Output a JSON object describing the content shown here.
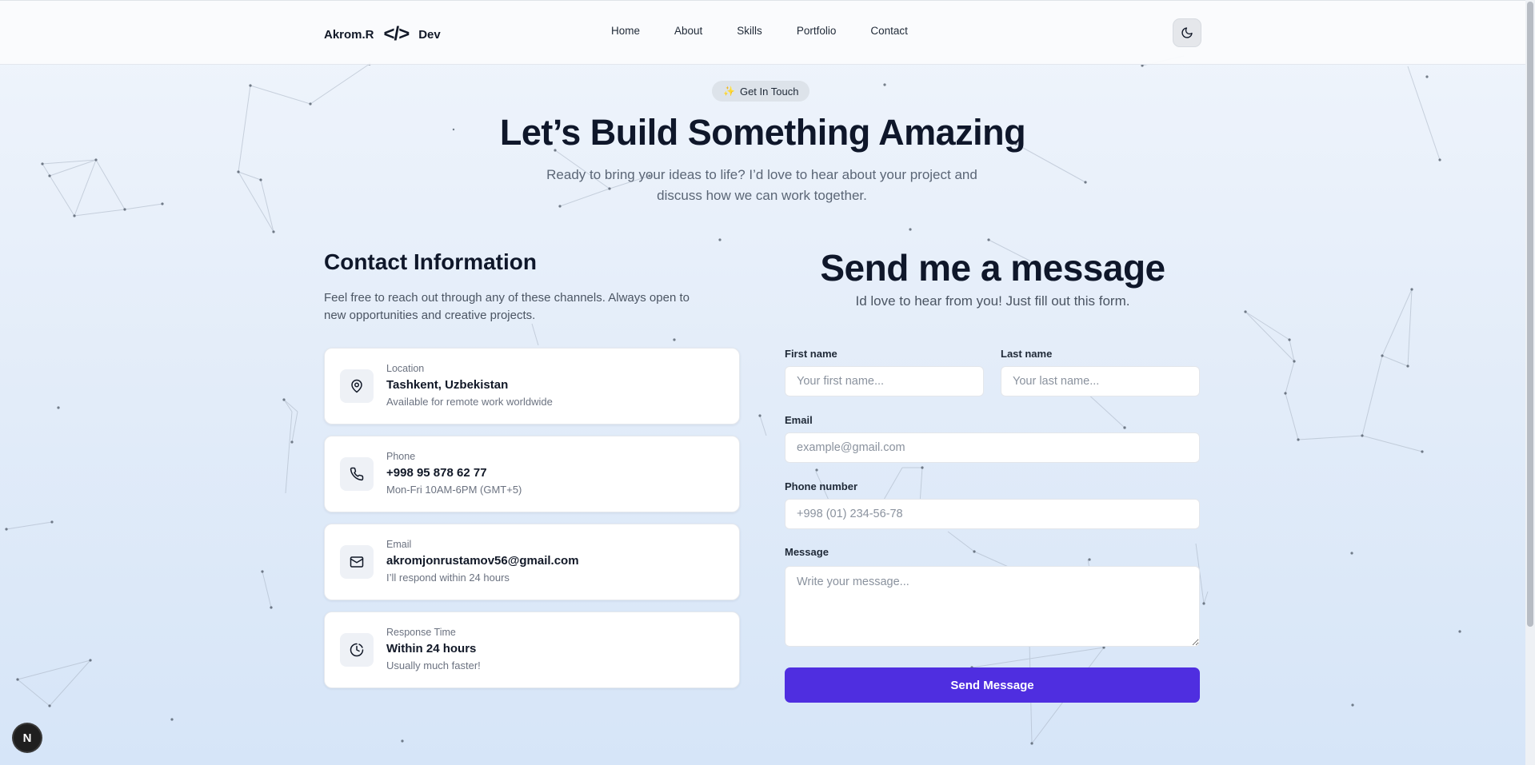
{
  "nav": {
    "brand_name": "Akrom.R",
    "brand_glyph": "</>",
    "brand_suffix": "Dev",
    "links": [
      "Home",
      "About",
      "Skills",
      "Portfolio",
      "Contact"
    ],
    "theme_icon": "moon-icon"
  },
  "hero": {
    "badge": "Get In Touch",
    "badge_icon": "sparkles-icon",
    "title": "Let’s Build Something Amazing",
    "subtitle": "Ready to bring your ideas to life? I’d love to hear about your project and discuss how we can work together."
  },
  "contact_info": {
    "title": "Contact Information",
    "description": "Feel free to reach out through any of these channels. Always open to new opportunities and creative projects.",
    "cards": [
      {
        "icon": "map-pin-icon",
        "label": "Location",
        "value": "Tashkent, Uzbekistan",
        "note": "Available for remote work worldwide"
      },
      {
        "icon": "phone-icon",
        "label": "Phone",
        "value": "+998 95 878 62 77",
        "note": "Mon-Fri 10AM-6PM (GMT+5)"
      },
      {
        "icon": "mail-icon",
        "label": "Email",
        "value": "akromjonrustamov56@gmail.com",
        "note": "I’ll respond within 24 hours"
      },
      {
        "icon": "clock-icon",
        "label": "Response Time",
        "value": "Within 24 hours",
        "note": "Usually much faster!"
      }
    ]
  },
  "form": {
    "title": "Send me a message",
    "subtitle": "Id love to hear from you! Just fill out this form.",
    "first_name": {
      "label": "First name",
      "placeholder": "Your first name...",
      "value": ""
    },
    "last_name": {
      "label": "Last name",
      "placeholder": "Your last name...",
      "value": ""
    },
    "email": {
      "label": "Email",
      "placeholder": "example@gmail.com",
      "value": ""
    },
    "phone": {
      "label": "Phone number",
      "placeholder": "+998 (01) 234-56-78",
      "value": ""
    },
    "message": {
      "label": "Message",
      "placeholder": "Write your message...",
      "value": ""
    },
    "submit": "Send Message"
  },
  "dev_badge": "N",
  "colors": {
    "accent": "#4f2ee0",
    "background_top": "#f0f5fc",
    "background_bottom": "#d6e5f8",
    "text_dark": "#0f172a"
  }
}
